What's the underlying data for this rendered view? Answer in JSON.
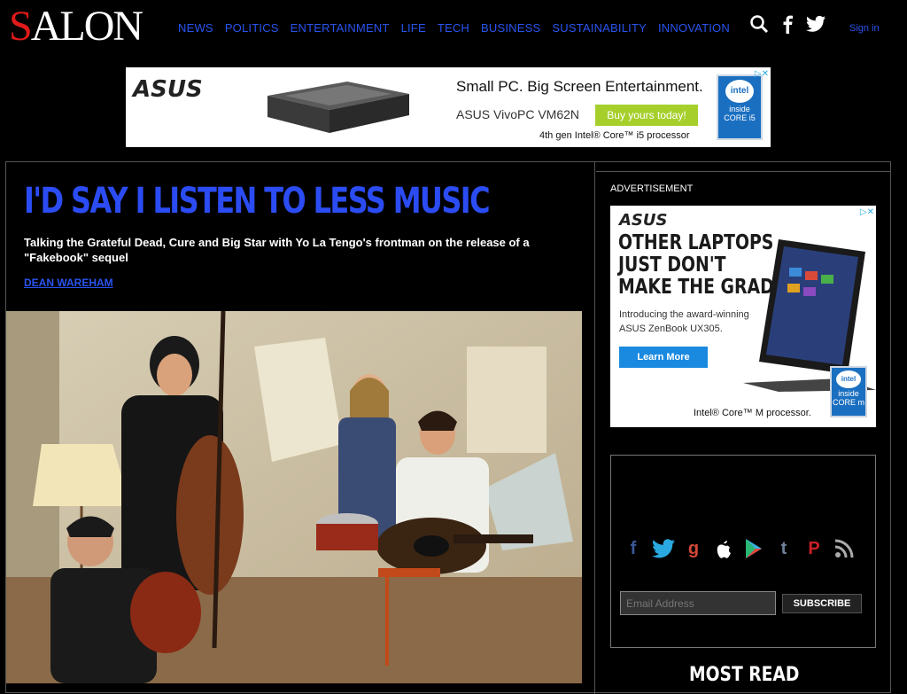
{
  "header": {
    "logo_first": "S",
    "logo_rest": "ALON",
    "nav": [
      "NEWS",
      "POLITICS",
      "ENTERTAINMENT",
      "LIFE",
      "TECH",
      "BUSINESS",
      "SUSTAINABILITY",
      "INNOVATION"
    ],
    "signin": "Sign in",
    "accent_color": "#2a54f0",
    "logo_accent_color": "#e01a1a"
  },
  "top_ad": {
    "brand": "ASUS",
    "headline": "Small PC. Big Screen Entertainment.",
    "model": "ASUS VivoPC VM62N",
    "cta": "Buy yours today!",
    "processor": "4th gen Intel® Core™ i5 processor",
    "intel_inside": "intel",
    "intel_sub": "inside",
    "intel_core": "CORE i5"
  },
  "article": {
    "headline": "I'D SAY I LISTEN TO LESS MUSIC",
    "subhead": "Talking the Grateful Dead, Cure and Big Star with Yo La Tengo's frontman on the release of a \"Fakebook\" sequel",
    "byline": "DEAN WAREHAM"
  },
  "sidebar": {
    "ad_label": "ADVERTISEMENT",
    "ad": {
      "brand": "ASUS",
      "headline_1": "OTHER LAPTOPS",
      "headline_2": "JUST DON'T",
      "headline_3": "MAKE THE GRADE.",
      "intro": "Introducing the award-winning ASUS ZenBook UX305.",
      "cta": "Learn More",
      "core": "Intel® Core™ M processor.",
      "intel_inside": "intel",
      "intel_sub": "inside",
      "intel_core": "CORE m"
    },
    "social_icons": [
      "facebook-icon",
      "twitter-icon",
      "google-plus-icon",
      "apple-icon",
      "google-play-icon",
      "tumblr-icon",
      "pinterest-icon",
      "rss-icon"
    ],
    "email_placeholder": "Email Address",
    "subscribe": "SUBSCRIBE",
    "most_read": "MOST READ"
  }
}
